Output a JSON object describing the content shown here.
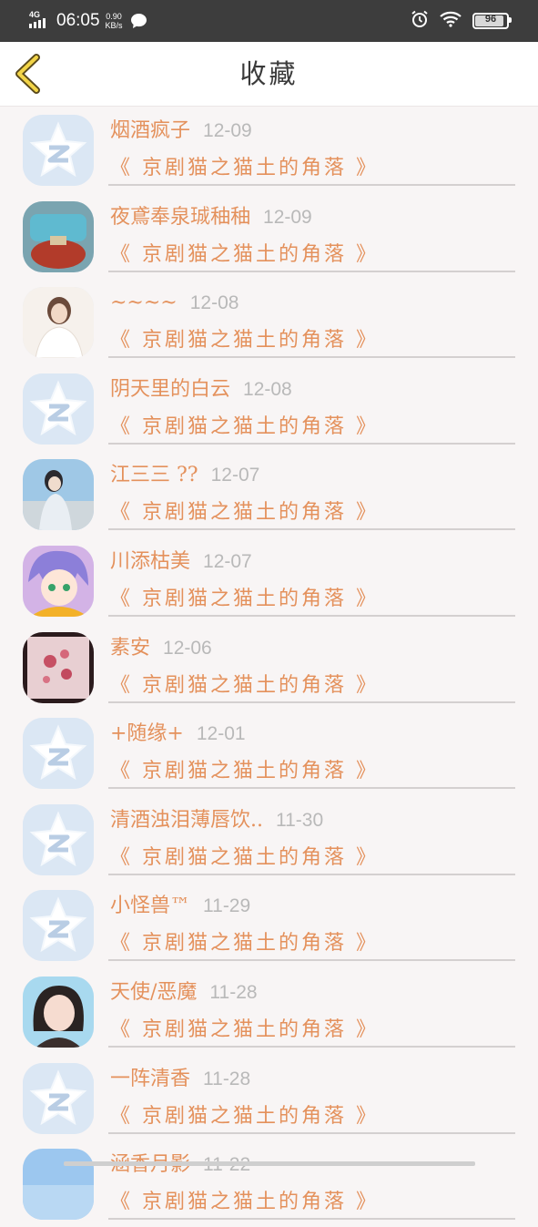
{
  "status_bar": {
    "network": "4G",
    "time": "06:05",
    "speed_value": "0.90",
    "speed_unit": "KB/s",
    "battery_level": "96"
  },
  "header": {
    "title": "收藏",
    "back_icon": "chevron-left-icon"
  },
  "colors": {
    "accent": "#e4915c",
    "date": "#b9b9b9",
    "header_bg": "#ffffff",
    "status_bar_bg": "#3d3d3d",
    "list_bg": "#f8f5f5"
  },
  "favorites": [
    {
      "name": "烟酒疯子",
      "date": "12-09",
      "title": "《 京剧猫之猫土的角落 》",
      "avatar": "default-qq-star"
    },
    {
      "name": "夜鳶奉泉珹秞秞",
      "date": "12-09",
      "title": "《 京剧猫之猫土的角落 》",
      "avatar": "perfume-bottle-photo"
    },
    {
      "name": "~~~~",
      "date": "12-08",
      "title": "《 京剧猫之猫土的角落 》",
      "avatar": "girl-photo"
    },
    {
      "name": "阴天里的白云",
      "date": "12-08",
      "title": "《 京剧猫之猫土的角落 》",
      "avatar": "default-qq-star"
    },
    {
      "name": "江三三 ??",
      "date": "12-07",
      "title": "《 京剧猫之猫土的角落 》",
      "avatar": "girl-by-sea-photo"
    },
    {
      "name": "川添枯美",
      "date": "12-07",
      "title": "《 京剧猫之猫土的角落 》",
      "avatar": "anime-character"
    },
    {
      "name": "素安",
      "date": "12-06",
      "title": "《 京剧猫之猫土的角落 》",
      "avatar": "pink-flowers-photo"
    },
    {
      "name": "+随缘+",
      "date": "12-01",
      "title": "《 京剧猫之猫土的角落 》",
      "avatar": "default-qq-star"
    },
    {
      "name": "清酒浊泪薄唇饮..",
      "date": "11-30",
      "title": "《 京剧猫之猫土的角落 》",
      "avatar": "default-qq-star"
    },
    {
      "name": "小怪兽™",
      "date": "11-29",
      "title": "《 京剧猫之猫土的角落 》",
      "avatar": "default-qq-star"
    },
    {
      "name": "天使/恶魔",
      "date": "11-28",
      "title": "《 京剧猫之猫土的角落 》",
      "avatar": "cartoon-girl"
    },
    {
      "name": "一阵清香",
      "date": "11-28",
      "title": "《 京剧猫之猫土的角落 》",
      "avatar": "default-qq-star"
    },
    {
      "name": "涵香月影",
      "date": "11-22",
      "title": "《 京剧猫之猫土的角落 》",
      "avatar": "blue-photo"
    }
  ]
}
